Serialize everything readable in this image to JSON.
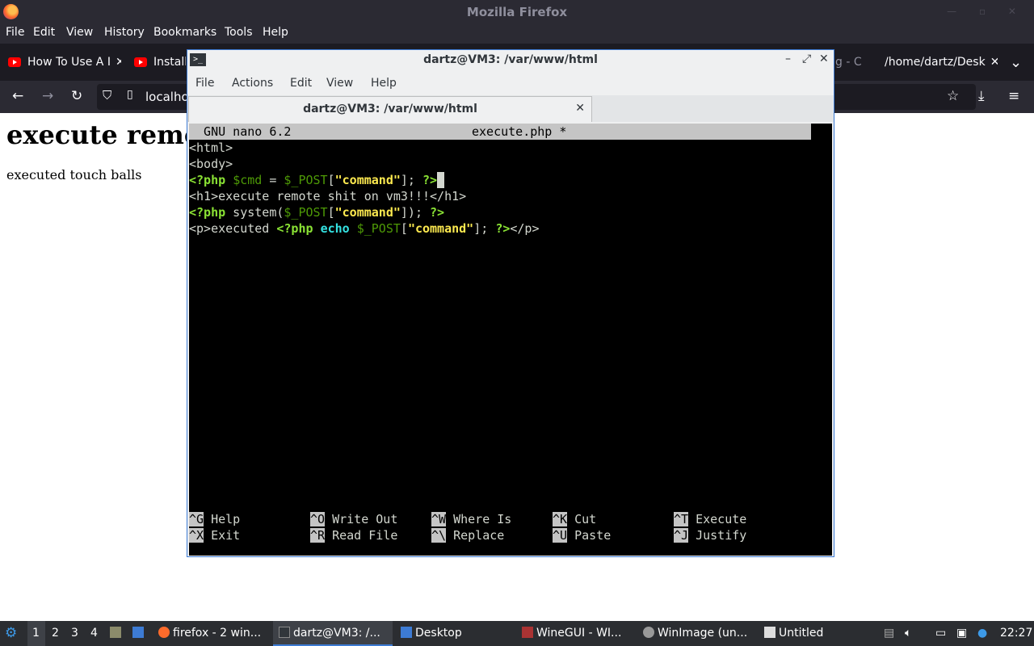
{
  "firefox": {
    "window_title": "Mozilla Firefox",
    "menu": [
      "File",
      "Edit",
      "View",
      "History",
      "Bookmarks",
      "Tools",
      "Help"
    ],
    "tabs": [
      {
        "label": "How To Use A I"
      },
      {
        "label": "Installi"
      },
      {
        "label": "g - C"
      },
      {
        "label": "/home/dartz/Desk"
      }
    ],
    "url": "localho"
  },
  "page": {
    "heading": "execute remo",
    "paragraph": "executed touch balls"
  },
  "terminal": {
    "title": "dartz@VM3: /var/www/html",
    "menu": [
      "File",
      "Actions",
      "Edit",
      "View",
      "Help"
    ],
    "tab_label": "dartz@VM3: /var/www/html",
    "nano_version": "  GNU nano 6.2",
    "filename": "execute.php *",
    "lines": [
      "<html>",
      "<body>",
      "<?php $cmd = $_POST[\"command\"]; ?>",
      "<h1>execute remote shit on vm3!!!</h1>",
      "<?php system($_POST[\"command\"]); ?>",
      "<p>executed <?php echo $_POST[\"command\"]; ?></p>"
    ],
    "shortcuts": [
      {
        "key": "^G",
        "label": "Help"
      },
      {
        "key": "^O",
        "label": "Write Out"
      },
      {
        "key": "^W",
        "label": "Where Is"
      },
      {
        "key": "^K",
        "label": "Cut"
      },
      {
        "key": "^T",
        "label": "Execute"
      },
      {
        "key": "^X",
        "label": "Exit"
      },
      {
        "key": "^R",
        "label": "Read File"
      },
      {
        "key": "^\\",
        "label": "Replace"
      },
      {
        "key": "^U",
        "label": "Paste"
      },
      {
        "key": "^J",
        "label": "Justify"
      }
    ]
  },
  "taskbar": {
    "workspaces": [
      "1",
      "2",
      "3",
      "4"
    ],
    "items": [
      {
        "label": "firefox - 2 win..."
      },
      {
        "label": "dartz@VM3: /..."
      },
      {
        "label": "Desktop"
      },
      {
        "label": "WineGUI - WI..."
      },
      {
        "label": "WinImage (un..."
      },
      {
        "label": "Untitled"
      }
    ],
    "clock": "22:27"
  }
}
